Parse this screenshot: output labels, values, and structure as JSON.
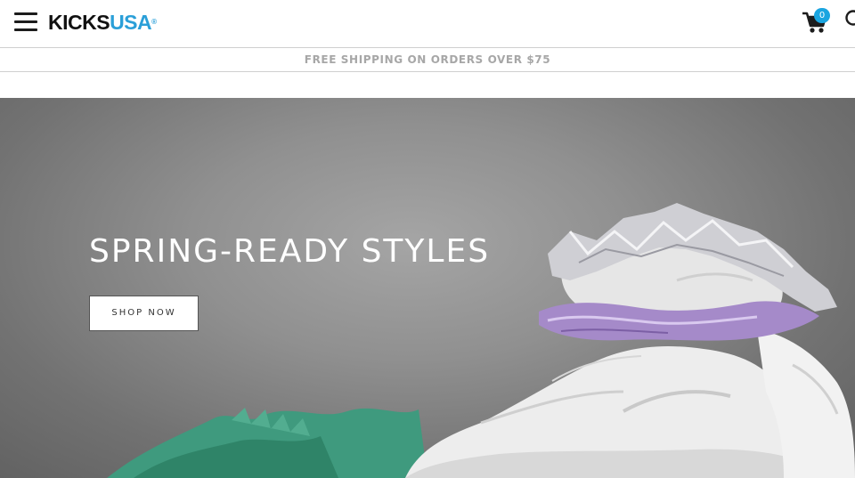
{
  "header": {
    "logo": {
      "part1": "KICKS",
      "part2": "USA",
      "mark": "®"
    },
    "icons": {
      "menu": "hamburger-menu-icon",
      "cart": "shopping-cart-icon",
      "search": "search-icon"
    },
    "cart_count": "0"
  },
  "promo": {
    "text": "FREE SHIPPING ON ORDERS OVER $75"
  },
  "hero": {
    "title": "SPRING-READY STYLES",
    "cta_label": "SHOP NOW"
  },
  "colors": {
    "brand_blue": "#2a9fd8",
    "badge_blue": "#1aa5e0",
    "promo_text": "#a7a7a7"
  }
}
